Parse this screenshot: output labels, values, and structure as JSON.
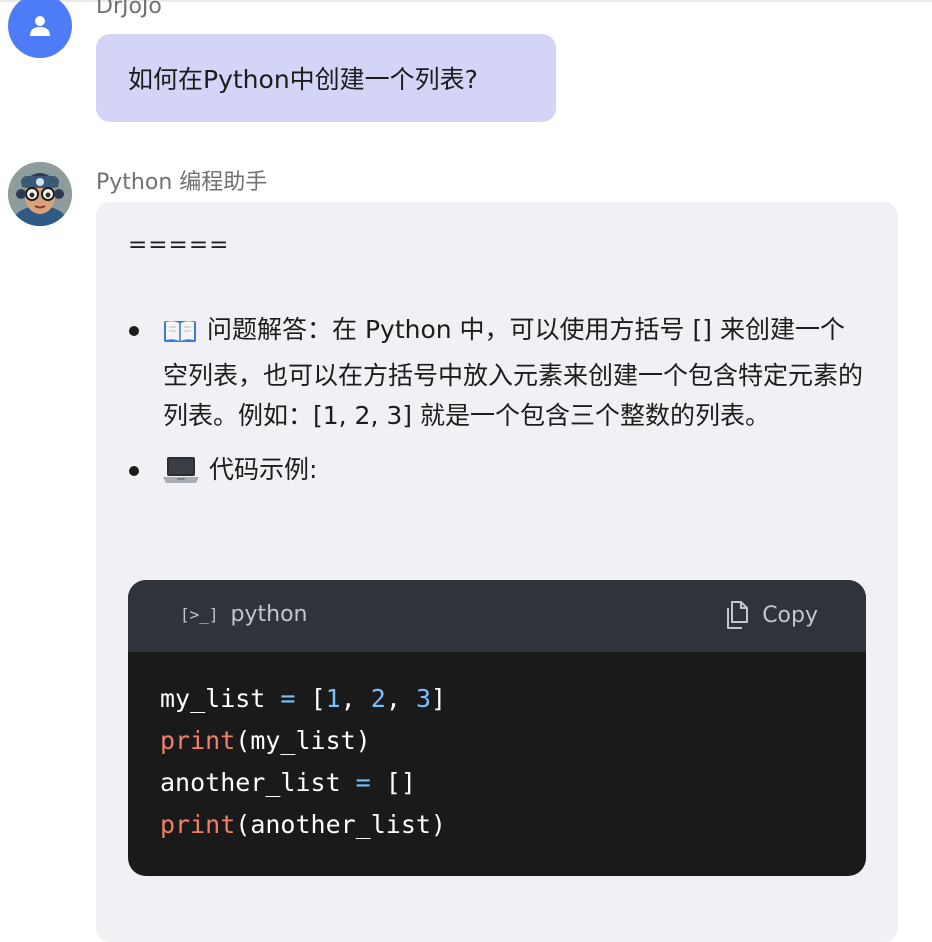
{
  "user": {
    "name": "DrJoJo",
    "message": "如何在Python中创建一个列表?"
  },
  "assistant": {
    "name": "Python 编程助手",
    "separator": "=====",
    "bullets": [
      {
        "icon": "open-book-emoji",
        "text": "问题解答：在 Python 中，可以使用方括号 [] 来创建一个空列表，也可以在方括号中放入元素来创建一个包含特定元素的列表。例如：[1, 2, 3] 就是一个包含三个整数的列表。"
      },
      {
        "icon": "laptop-emoji",
        "text": "代码示例:"
      }
    ],
    "code_block": {
      "language": "python",
      "terminal_glyph": "[>_]",
      "copy_label": "Copy",
      "lines": [
        [
          {
            "t": "my_list ",
            "c": ""
          },
          {
            "t": "=",
            "c": "op"
          },
          {
            "t": " [",
            "c": ""
          },
          {
            "t": "1",
            "c": "num"
          },
          {
            "t": ", ",
            "c": ""
          },
          {
            "t": "2",
            "c": "num"
          },
          {
            "t": ", ",
            "c": ""
          },
          {
            "t": "3",
            "c": "num"
          },
          {
            "t": "]",
            "c": ""
          }
        ],
        [
          {
            "t": "print",
            "c": "fn"
          },
          {
            "t": "(my_list)",
            "c": ""
          }
        ],
        [
          {
            "t": "another_list ",
            "c": ""
          },
          {
            "t": "=",
            "c": "op"
          },
          {
            "t": " []",
            "c": ""
          }
        ],
        [
          {
            "t": "print",
            "c": "fn"
          },
          {
            "t": "(another_list)",
            "c": ""
          }
        ]
      ]
    }
  },
  "colors": {
    "user_bubble": "#d4d4f7",
    "assistant_bubble": "#f1f1f5",
    "avatar_user": "#4e7cf6",
    "code_bg": "#1a1a1a",
    "code_header": "#30333a",
    "keyword_fn": "#f07f6a",
    "number": "#79c0ff"
  }
}
